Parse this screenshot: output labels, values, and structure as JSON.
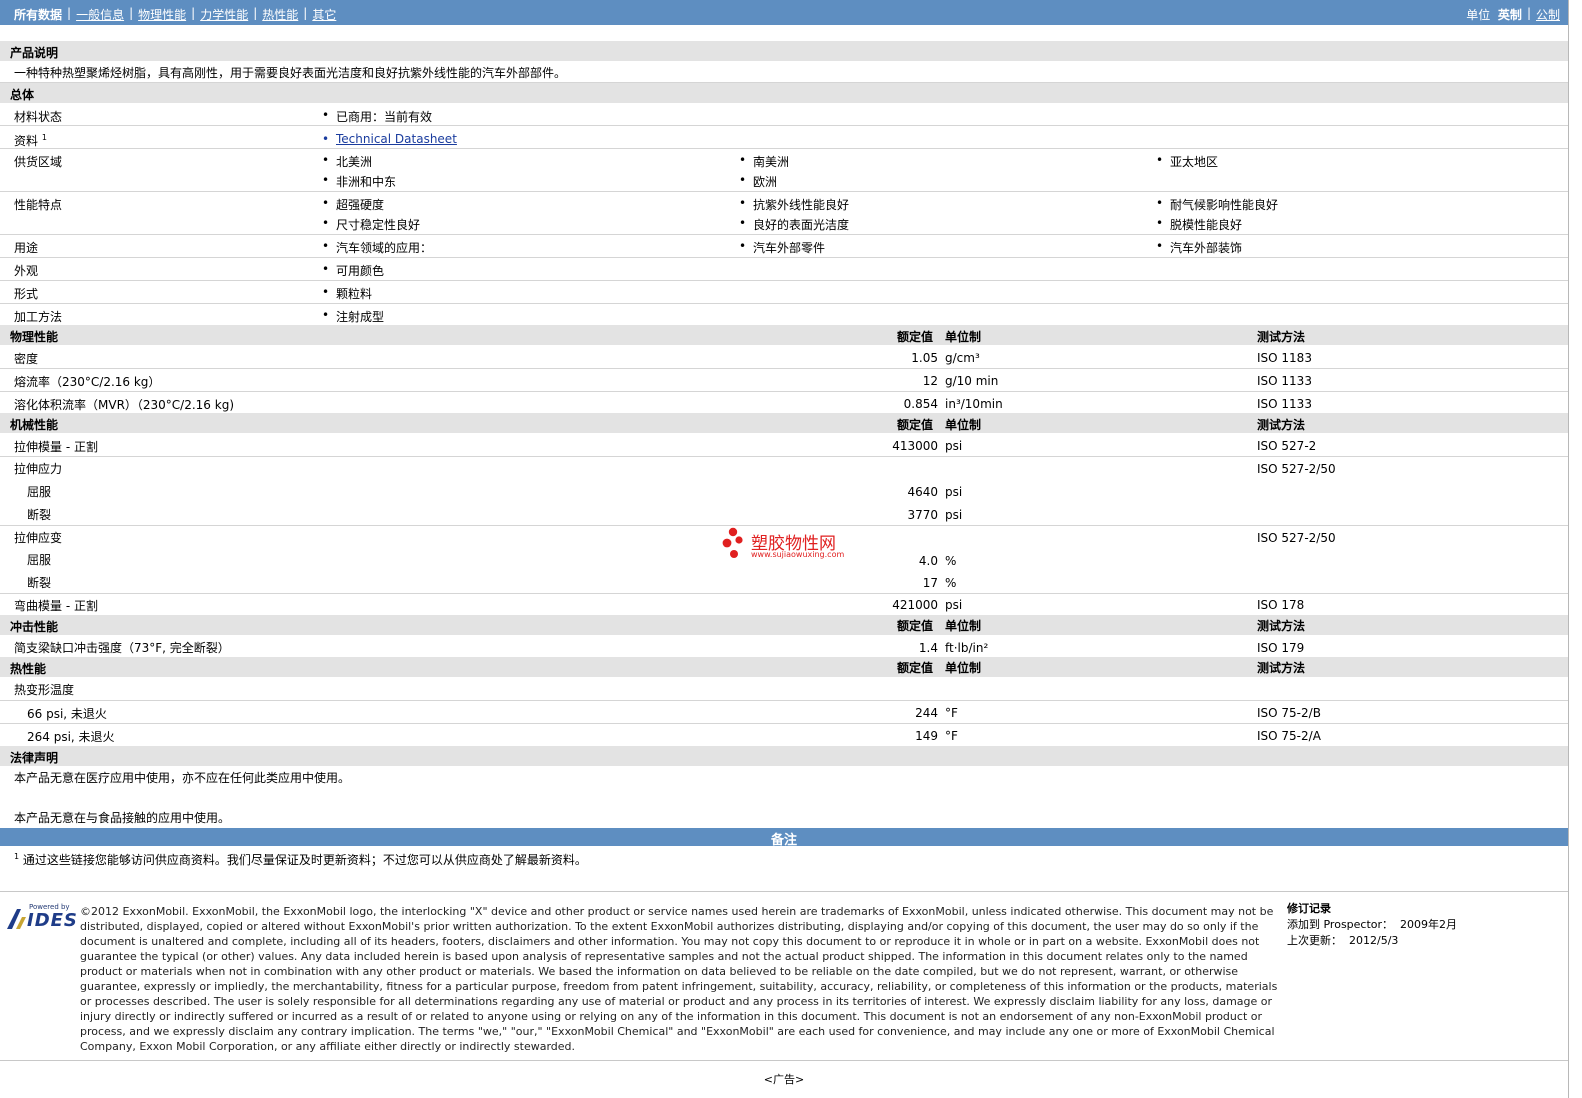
{
  "nav": {
    "items": [
      "所有数据",
      "一般信息",
      "物理性能",
      "力学性能",
      "热性能",
      "其它"
    ],
    "units_label": "单位",
    "unit_imperial": "英制",
    "unit_metric": "公制"
  },
  "columns": {
    "nominal": "额定值",
    "unit": "单位制",
    "test": "测试方法"
  },
  "description": {
    "title": "产品说明",
    "text": "一种特种热塑聚烯烃树脂，具有高刚性，用于需要良好表面光洁度和良好抗紫外线性能的汽车外部部件。"
  },
  "general": {
    "title": "总体",
    "material_status_label": "材料状态",
    "material_status": "已商用：当前有效",
    "literature_label": "资料",
    "literature_sup": "1",
    "literature_link": "Technical Datasheet",
    "availability_label": "供货区域",
    "availability": [
      "北美洲",
      "南美洲",
      "亚太地区",
      "非洲和中东",
      "欧洲"
    ],
    "features_label": "性能特点",
    "features": [
      "超强硬度",
      "抗紫外线性能良好",
      "耐气候影响性能良好",
      "尺寸稳定性良好",
      "良好的表面光洁度",
      "脱模性能良好"
    ],
    "uses_label": "用途",
    "uses": [
      "汽车领域的应用：",
      "汽车外部零件",
      "汽车外部装饰"
    ],
    "appearance_label": "外观",
    "appearance": "可用颜色",
    "form_label": "形式",
    "form": "颗粒料",
    "processing_label": "加工方法",
    "processing": "注射成型"
  },
  "physical": {
    "title": "物理性能",
    "rows": [
      {
        "label": "密度",
        "value": "1.05",
        "unit": "g/cm³",
        "test": "ISO 1183"
      },
      {
        "label": "熔流率（230°C/2.16 kg）",
        "value": "12",
        "unit": "g/10 min",
        "test": "ISO 1133"
      },
      {
        "label": "溶化体积流率（MVR）（230°C/2.16 kg)",
        "value": "0.854",
        "unit": "in³/10min",
        "test": "ISO 1133"
      }
    ]
  },
  "mechanical": {
    "title": "机械性能",
    "tensile_modulus": {
      "label": "拉伸模量 - 正割",
      "value": "413000",
      "unit": "psi",
      "test": "ISO 527-2"
    },
    "tensile_stress": {
      "label": "拉伸应力",
      "test": "ISO 527-2/50"
    },
    "stress_yield": {
      "label": "屈服",
      "value": "4640",
      "unit": "psi"
    },
    "stress_break": {
      "label": "断裂",
      "value": "3770",
      "unit": "psi"
    },
    "tensile_strain": {
      "label": "拉伸应变",
      "test": "ISO 527-2/50"
    },
    "strain_yield": {
      "label": "屈服",
      "value": "4.0",
      "unit": "%"
    },
    "strain_break": {
      "label": "断裂",
      "value": "17",
      "unit": "%"
    },
    "flex_modulus": {
      "label": "弯曲模量 - 正割",
      "value": "421000",
      "unit": "psi",
      "test": "ISO 178"
    }
  },
  "impact": {
    "title": "冲击性能",
    "charpy": {
      "label": "简支梁缺口冲击强度（73°F, 完全断裂）",
      "value": "1.4",
      "unit": "ft·lb/in²",
      "test": "ISO 179"
    }
  },
  "thermal": {
    "title": "热性能",
    "hdt_label": "热变形温度",
    "hdt66": {
      "label": "66 psi, 未退火",
      "value": "244",
      "unit": "°F",
      "test": "ISO 75-2/B"
    },
    "hdt264": {
      "label": "264 psi, 未退火",
      "value": "149",
      "unit": "°F",
      "test": "ISO 75-2/A"
    }
  },
  "legal": {
    "title": "法律声明",
    "line1": "本产品无意在医疗应用中使用，亦不应在任何此类应用中使用。",
    "line2": "本产品无意在与食品接触的应用中使用。"
  },
  "notes": {
    "title": "备注",
    "sup": "1",
    "text": "通过这些链接您能够访问供应商资料。我们尽量保证及时更新资料；不过您可以从供应商处了解最新资料。"
  },
  "watermark": {
    "text": "塑胶物性网",
    "url": "www.sujiaowuxing.com"
  },
  "footer": {
    "logo_small": "Powered by",
    "logo_text": "IDES",
    "copyright": "©2012 ExxonMobil. ExxonMobil, the ExxonMobil logo, the interlocking \"X\" device and other product or service names used herein are trademarks of ExxonMobil, unless indicated otherwise. This document may not be distributed, displayed, copied or altered without ExxonMobil's prior written authorization. To the extent ExxonMobil authorizes distributing, displaying and/or copying of this document, the user may do so only if the document is unaltered and complete, including all of its headers, footers, disclaimers and other information. You may not copy this document to or reproduce it in whole or in part on a website. ExxonMobil does not guarantee the typical (or other) values. Any data included herein is based upon analysis of representative samples and not the actual product shipped. The information in this document relates only to the named product or materials when not in combination with any other product or materials. We based the information on data believed to be reliable on the date compiled, but we do not represent, warrant, or otherwise guarantee, expressly or impliedly, the merchantability, fitness for a particular purpose, freedom from patent infringement, suitability, accuracy, reliability, or completeness of this information or the products, materials or processes described. The user is solely responsible for all determinations regarding any use of material or product and any process in its territories of interest. We expressly disclaim liability for any loss, damage or injury directly or indirectly suffered or incurred as a result of or related to anyone using or relying on any of the information in this document. This document is not an endorsement of any non-ExxonMobil product or process, and we expressly disclaim any contrary implication. The terms \"we,\" \"our,\" \"ExxonMobil Chemical\" and \"ExxonMobil\" are each used for convenience, and may include any one or more of ExxonMobil Chemical Company, Exxon Mobil Corporation, or any affiliate either directly or indirectly stewarded.",
    "revision_title": "修订记录",
    "added_label": "添加到 Prospector：",
    "added_value": "2009年2月",
    "updated_label": "上次更新：",
    "updated_value": "2012/5/3",
    "ad": "<广告>"
  }
}
